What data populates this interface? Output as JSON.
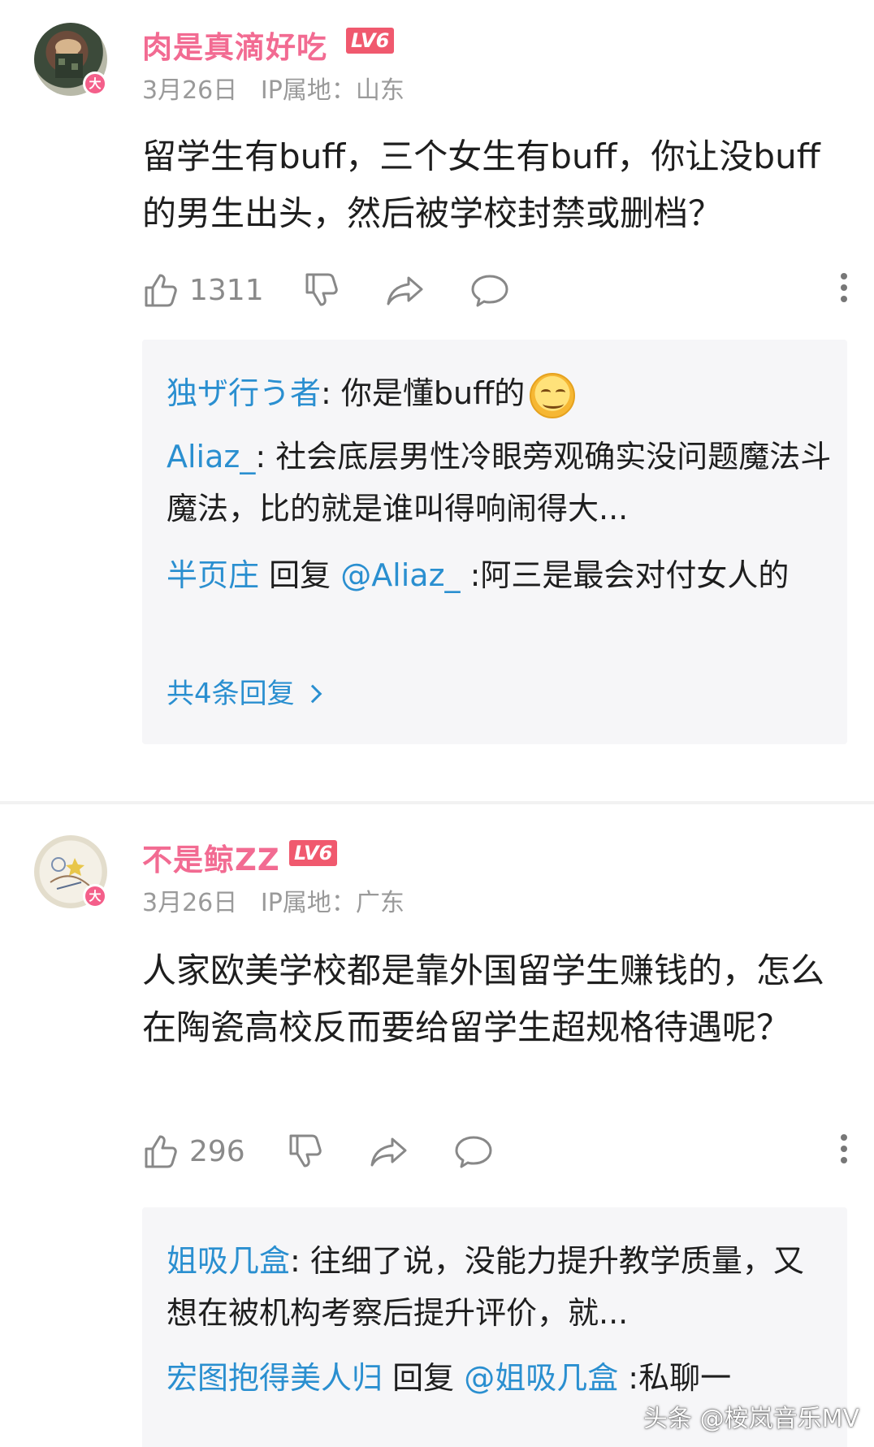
{
  "comments": [
    {
      "username": "肉是真滴好吃",
      "level": "LV6",
      "badge": "大",
      "date": "3月26日",
      "ip": "IP属地：山东",
      "text": "留学生有buff，三个女生有buff，你让没buff的男生出头，然后被学校封禁或删档？",
      "likes": "1311",
      "replies": [
        {
          "name": "独ザ行う者",
          "text": ": 你是懂buff的"
        },
        {
          "name": "Aliaz_",
          "text": ": 社会底层男性冷眼旁观确实没问题魔法斗魔法，比的就是谁叫得响闹得大..."
        },
        {
          "name": "半页庄",
          "reply_word": " 回复 ",
          "mention": "@Aliaz_",
          "text": " :阿三是最会对付女人的"
        }
      ],
      "more_replies": "共4条回复"
    },
    {
      "username": "不是鲸ZZ",
      "level": "LV6",
      "badge": "大",
      "date": "3月26日",
      "ip": "IP属地：广东",
      "text": "人家欧美学校都是靠外国留学生赚钱的，怎么在陶瓷高校反而要给留学生超规格待遇呢？",
      "likes": "296",
      "replies": [
        {
          "name": "姐吸几盒",
          "text": ": 往细了说，没能力提升教学质量，又想在被机构考察后提升评价，就..."
        },
        {
          "name": "宏图抱得美人归",
          "reply_word": " 回复 ",
          "mention": "@姐吸几盒",
          "text": " :私聊一"
        }
      ]
    }
  ],
  "watermark": "头条 @桉岚音乐MV",
  "colors": {
    "username": "#f26b92",
    "reply_name": "#2a8fd0",
    "level_bg": "#f0596e"
  }
}
